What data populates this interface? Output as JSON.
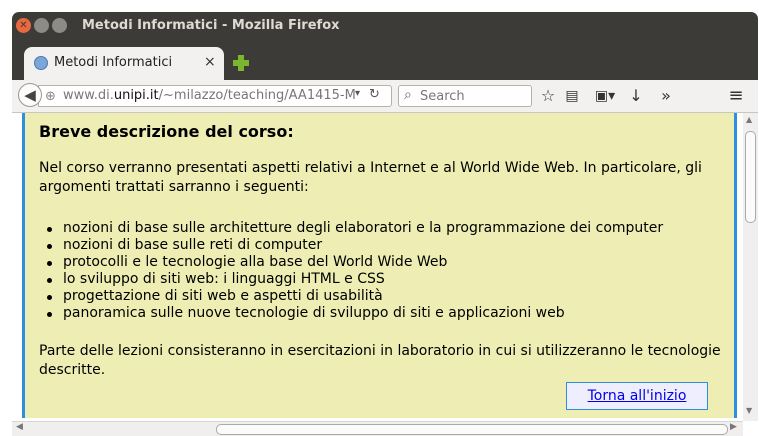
{
  "browser": {
    "window_title": "Metodi Informatici - Mozilla Firefox",
    "tab_label": "Metodi Informatici",
    "tab_close": "×",
    "url_prefix": "www.di.",
    "url_domain": "unipi.it",
    "url_path": "/~milazzo/teaching/AA1415-M",
    "search_placeholder": "Search",
    "toolbar_icons": [
      "back-icon",
      "globe-icon",
      "reload-icon",
      "search-icon",
      "bookmark-star-icon",
      "reading-list-icon",
      "print-icon",
      "download-icon",
      "overflow-icon",
      "menu-icon"
    ]
  },
  "page": {
    "heading": "Breve descrizione del corso:",
    "intro": "Nel corso verranno presentati aspetti relativi a Internet e al World Wide Web. In particolare, gli argomenti trattati sarranno i seguenti:",
    "topics": [
      "nozioni di base sulle architetture degli elaboratori e la programmazione dei computer",
      "nozioni di base sulle reti di computer",
      "protocolli e le tecnologie alla base del World Wide Web",
      "lo sviluppo di siti web: i linguaggi HTML e CSS",
      "progettazione di siti web e aspetti di usabilità",
      "panoramica sulle nuove tecnologie di sviluppo di siti e applicazioni web"
    ],
    "outro": "Parte delle lezioni consisteranno in esercitazioni in laboratorio in cui si utilizzeranno le tecnologie descritte.",
    "back_to_top": "Torna all'inizio"
  },
  "colors": {
    "content_bg": "#eeeeb4",
    "content_border": "#2c8fe2",
    "titlebar": "#3c3b37",
    "close_button": "#e9683d",
    "link": "#0000ee"
  }
}
